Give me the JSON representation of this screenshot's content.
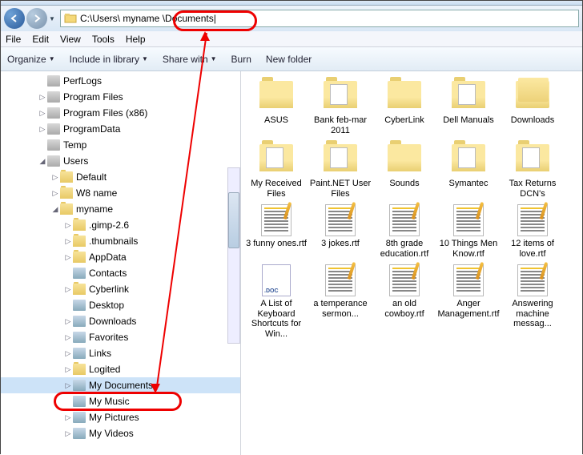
{
  "address": {
    "path_prefix": "C:\\Users\\ myname",
    "path_suffix": " \\Documents"
  },
  "menu": {
    "file": "File",
    "edit": "Edit",
    "view": "View",
    "tools": "Tools",
    "help": "Help"
  },
  "toolbar": {
    "organize": "Organize",
    "include": "Include in library",
    "share": "Share with",
    "burn": "Burn",
    "newfolder": "New folder"
  },
  "tree": [
    {
      "indent": 46,
      "exp": "",
      "icon": "drive",
      "label": "PerfLogs"
    },
    {
      "indent": 46,
      "exp": "▷",
      "icon": "drive",
      "label": "Program Files"
    },
    {
      "indent": 46,
      "exp": "▷",
      "icon": "drive",
      "label": "Program Files (x86)"
    },
    {
      "indent": 46,
      "exp": "▷",
      "icon": "drive",
      "label": "ProgramData"
    },
    {
      "indent": 46,
      "exp": "",
      "icon": "drive",
      "label": "Temp"
    },
    {
      "indent": 46,
      "exp": "◢",
      "icon": "drive",
      "label": "Users"
    },
    {
      "indent": 62,
      "exp": "▷",
      "icon": "folder",
      "label": "Default"
    },
    {
      "indent": 62,
      "exp": "▷",
      "icon": "folder",
      "label": "W8 name"
    },
    {
      "indent": 62,
      "exp": "◢",
      "icon": "folder",
      "label": "myname"
    },
    {
      "indent": 78,
      "exp": "▷",
      "icon": "folder",
      "label": ".gimp-2.6"
    },
    {
      "indent": 78,
      "exp": "▷",
      "icon": "folder",
      "label": ".thumbnails"
    },
    {
      "indent": 78,
      "exp": "▷",
      "icon": "folder",
      "label": "AppData"
    },
    {
      "indent": 78,
      "exp": "",
      "icon": "sys",
      "label": "Contacts"
    },
    {
      "indent": 78,
      "exp": "▷",
      "icon": "folder",
      "label": "Cyberlink"
    },
    {
      "indent": 78,
      "exp": "",
      "icon": "sys",
      "label": "Desktop"
    },
    {
      "indent": 78,
      "exp": "▷",
      "icon": "sys",
      "label": "Downloads"
    },
    {
      "indent": 78,
      "exp": "▷",
      "icon": "sys",
      "label": "Favorites"
    },
    {
      "indent": 78,
      "exp": "▷",
      "icon": "sys",
      "label": "Links"
    },
    {
      "indent": 78,
      "exp": "▷",
      "icon": "folder",
      "label": "Logited"
    },
    {
      "indent": 78,
      "exp": "▷",
      "icon": "sys",
      "label": "My Documents",
      "selected": true
    },
    {
      "indent": 78,
      "exp": "",
      "icon": "sys",
      "label": "My Music"
    },
    {
      "indent": 78,
      "exp": "▷",
      "icon": "sys",
      "label": "My Pictures"
    },
    {
      "indent": 78,
      "exp": "▷",
      "icon": "sys",
      "label": "My Videos"
    }
  ],
  "files": [
    {
      "type": "folder",
      "label": "ASUS"
    },
    {
      "type": "folder-doc",
      "label": "Bank feb-mar 2011"
    },
    {
      "type": "folder",
      "label": "CyberLink"
    },
    {
      "type": "folder-doc",
      "label": "Dell Manuals"
    },
    {
      "type": "folder-stack",
      "label": "Downloads"
    },
    {
      "type": "folder-doc",
      "label": "My Received Files"
    },
    {
      "type": "folder-doc",
      "label": "Paint.NET User Files"
    },
    {
      "type": "folder",
      "label": "Sounds"
    },
    {
      "type": "folder-doc",
      "label": "Symantec"
    },
    {
      "type": "folder-doc",
      "label": "Tax Returns DCN's"
    },
    {
      "type": "rtf",
      "label": "3 funny ones.rtf"
    },
    {
      "type": "rtf",
      "label": "3 jokes.rtf"
    },
    {
      "type": "rtf",
      "label": "8th grade education.rtf"
    },
    {
      "type": "rtf",
      "label": "10 Things Men Know.rtf"
    },
    {
      "type": "rtf",
      "label": "12 items of love.rtf"
    },
    {
      "type": "doc",
      "label": "A List of Keyboard Shortcuts for Win..."
    },
    {
      "type": "rtf",
      "label": "a temperance sermon..."
    },
    {
      "type": "rtf",
      "label": "an old cowboy.rtf"
    },
    {
      "type": "rtf",
      "label": "Anger Management.rtf"
    },
    {
      "type": "rtf",
      "label": "Answering machine messag..."
    }
  ]
}
